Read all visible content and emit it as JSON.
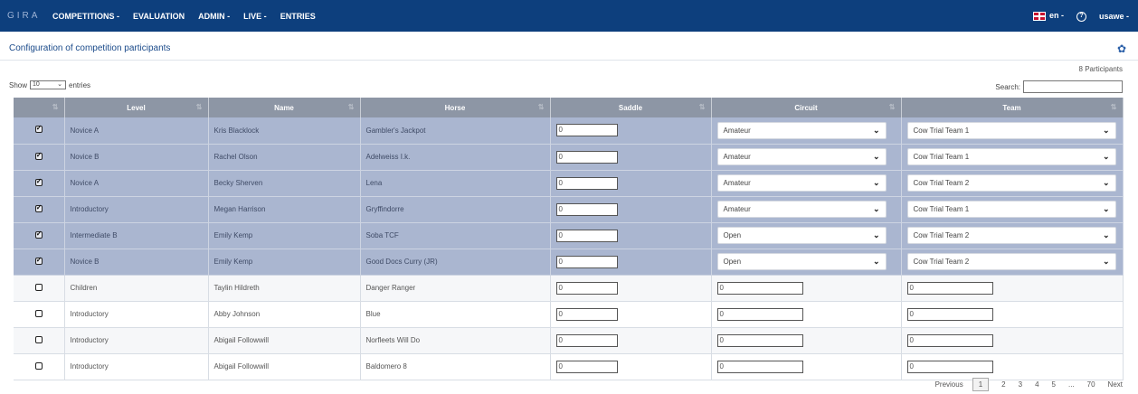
{
  "nav": {
    "brand": "GIRA",
    "items": [
      "COMPETITIONS -",
      "EVALUATION",
      "ADMIN -",
      "LIVE -",
      "ENTRIES"
    ],
    "lang": "en -",
    "help": "?",
    "user": "usawe -"
  },
  "page": {
    "title": "Configuration of competition participants",
    "count": "8 Participants"
  },
  "controls": {
    "show_label": "Show",
    "show_value": "10",
    "entries_label": "entries",
    "search_label": "Search:"
  },
  "table": {
    "headers": [
      "",
      "Level",
      "Name",
      "Horse",
      "Saddle",
      "Circuit",
      "Team"
    ],
    "rows": [
      {
        "checked": true,
        "level": "Novice A",
        "name": "Kris Blacklock",
        "horse": "Gambler's Jackpot",
        "saddle": "0",
        "circuit": "Amateur",
        "team": "Cow Trial Team 1"
      },
      {
        "checked": true,
        "level": "Novice B",
        "name": "Rachel Olson",
        "horse": "Adelweiss I.k.",
        "saddle": "0",
        "circuit": "Amateur",
        "team": "Cow Trial Team 1"
      },
      {
        "checked": true,
        "level": "Novice A",
        "name": "Becky Sherven",
        "horse": "Lena",
        "saddle": "0",
        "circuit": "Amateur",
        "team": "Cow Trial Team 2"
      },
      {
        "checked": true,
        "level": "Introductory",
        "name": "Megan Harrison",
        "horse": "Gryffindorre",
        "saddle": "0",
        "circuit": "Amateur",
        "team": "Cow Trial Team 1"
      },
      {
        "checked": true,
        "level": "Intermediate B",
        "name": "Emily Kemp",
        "horse": "Soba TCF",
        "saddle": "0",
        "circuit": "Open",
        "team": "Cow Trial Team 2"
      },
      {
        "checked": true,
        "level": "Novice B",
        "name": "Emily Kemp",
        "horse": "Good Docs Curry (JR)",
        "saddle": "0",
        "circuit": "Open",
        "team": "Cow Trial Team 2"
      },
      {
        "checked": false,
        "level": "Children",
        "name": "Taylin Hildreth",
        "horse": "Danger Ranger",
        "saddle": "0",
        "circuit": "0",
        "team": "0"
      },
      {
        "checked": false,
        "level": "Introductory",
        "name": "Abby Johnson",
        "horse": "Blue",
        "saddle": "0",
        "circuit": "0",
        "team": "0"
      },
      {
        "checked": false,
        "level": "Introductory",
        "name": "Abigail Followwill",
        "horse": "Norfleets Will Do",
        "saddle": "0",
        "circuit": "0",
        "team": "0"
      },
      {
        "checked": false,
        "level": "Introductory",
        "name": "Abigail Followwill",
        "horse": "Baldomero 8",
        "saddle": "0",
        "circuit": "0",
        "team": "0"
      }
    ]
  },
  "pagination": [
    "Previous",
    "1",
    "2",
    "3",
    "4",
    "5",
    "...",
    "70",
    "Next"
  ]
}
